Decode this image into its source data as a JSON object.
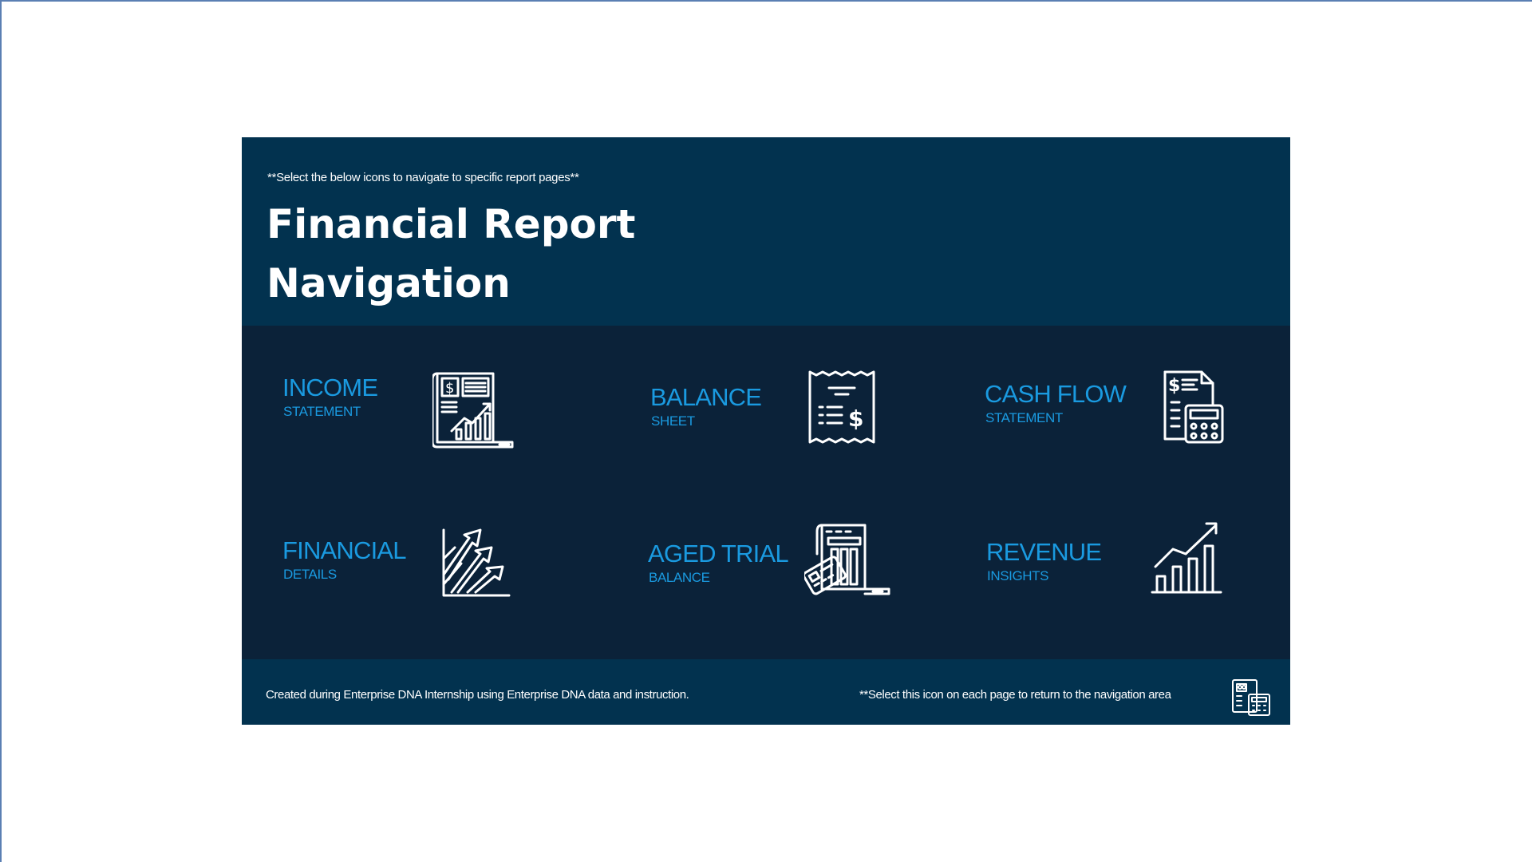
{
  "header": {
    "hint": "**Select the below icons to navigate to specific report pages**",
    "title_line1": "Financial Report",
    "title_line2": "Navigation"
  },
  "tiles": [
    {
      "main": "INCOME",
      "sub": "STATEMENT",
      "icon": "income-statement-icon"
    },
    {
      "main": "BALANCE",
      "sub": "SHEET",
      "icon": "receipt-dollar-icon"
    },
    {
      "main": "CASH FLOW",
      "sub": "STATEMENT",
      "icon": "document-calculator-icon"
    },
    {
      "main": "FINANCIAL",
      "sub": "DETAILS",
      "icon": "growth-arrows-icon"
    },
    {
      "main": "AGED TRIAL",
      "sub": "BALANCE",
      "icon": "ledger-card-icon"
    },
    {
      "main": "REVENUE",
      "sub": "INSIGHTS",
      "icon": "bar-chart-trend-icon"
    }
  ],
  "footer": {
    "credit": "Created during Enterprise DNA Internship using Enterprise DNA data and instruction.",
    "home_hint": "**Select this icon on each page to return to the navigation area",
    "home_icon": "home-navigation-icon"
  },
  "colors": {
    "header_bg": "#02324f",
    "body_bg": "#0b2239",
    "accent": "#1a9ae0",
    "text": "#ffffff"
  }
}
